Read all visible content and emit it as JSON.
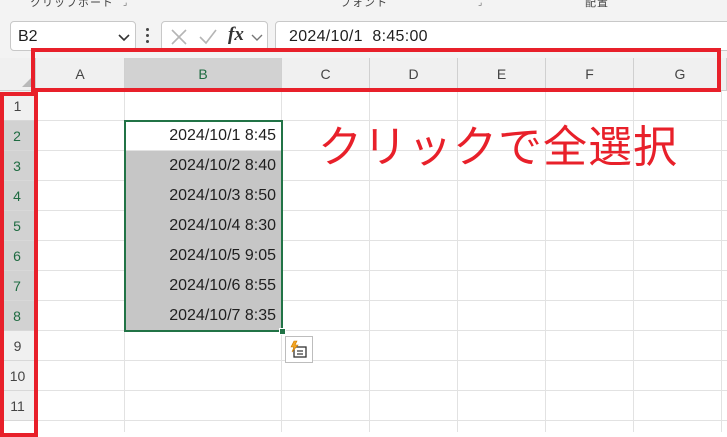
{
  "ribbon": {
    "groups": [
      "クリップボード",
      "フォント",
      "配置"
    ]
  },
  "formula_bar": {
    "name_box": "B2",
    "fx_label": "fx",
    "formula": "2024/10/1  8:45:00"
  },
  "sheet": {
    "columns": [
      "A",
      "B",
      "C",
      "D",
      "E",
      "F",
      "G"
    ],
    "rows": [
      "1",
      "2",
      "3",
      "4",
      "5",
      "6",
      "7",
      "8",
      "9",
      "10",
      "11"
    ],
    "selected_column": "B",
    "selected_rows": [
      "2",
      "3",
      "4",
      "5",
      "6",
      "7",
      "8"
    ],
    "cells_b": [
      "2024/10/1 8:45",
      "2024/10/2 8:40",
      "2024/10/3 8:50",
      "2024/10/4 8:30",
      "2024/10/5 9:05",
      "2024/10/6 8:55",
      "2024/10/7 8:35"
    ]
  },
  "annotation": {
    "text": "クリックで全選択",
    "color": "#e8202a"
  },
  "colors": {
    "accent": "#217346",
    "selection_fill": "#c6c6c6",
    "header_bg": "#f0f0f0"
  },
  "icons": {
    "name_box_dropdown": "chevron-down-icon",
    "cancel": "cancel-x-icon",
    "enter": "checkmark-icon",
    "function": "fx-icon",
    "quick_analysis": "quick-analysis-icon"
  }
}
